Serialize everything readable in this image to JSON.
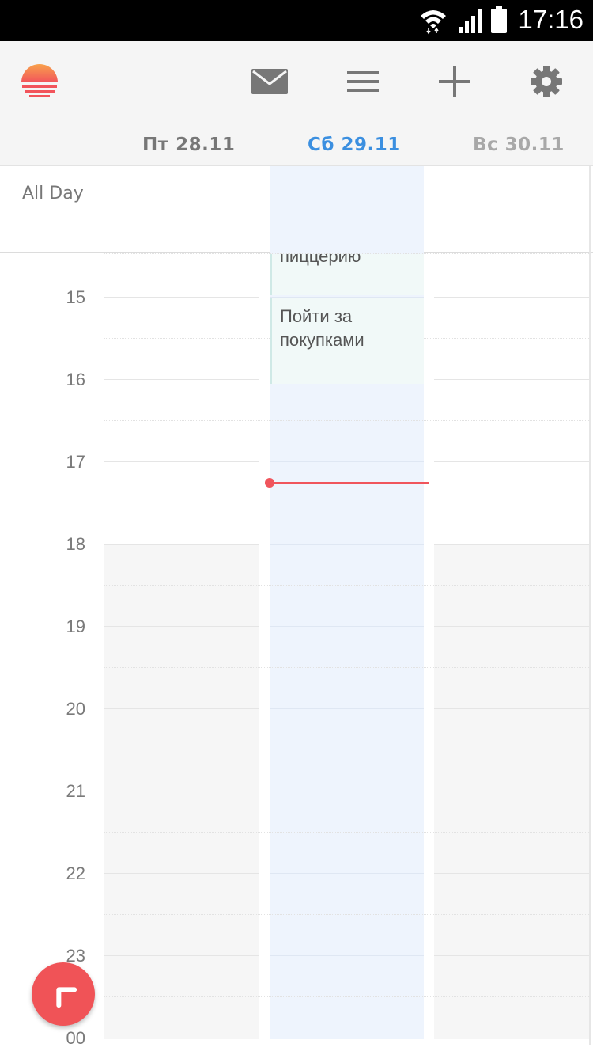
{
  "status_bar": {
    "time": "17:16"
  },
  "header": {
    "icons": [
      "sunrise-logo-icon",
      "mail-icon",
      "menu-icon",
      "add-icon",
      "gear-icon"
    ],
    "days": [
      {
        "label": "Пт 28.11"
      },
      {
        "label": "Сб 29.11",
        "selected": true
      },
      {
        "label": "Вс 30.11"
      }
    ]
  },
  "calendar": {
    "all_day_label": "All Day",
    "hours": [
      "15",
      "16",
      "17",
      "18",
      "19",
      "20",
      "21",
      "22",
      "23",
      "00"
    ],
    "events": [
      {
        "title": "пиццерию"
      },
      {
        "title_line1": "Пойти за",
        "title_line2": "покупками"
      }
    ]
  },
  "colors": {
    "accent": "#3b8fe0",
    "now_indicator": "#f0555c",
    "fab": "#f05357"
  }
}
